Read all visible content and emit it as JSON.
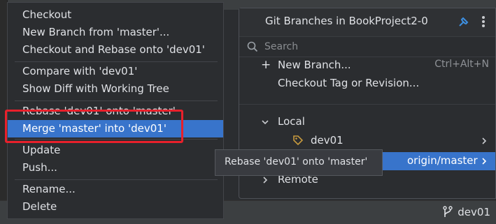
{
  "status_bar": {
    "branch_label": "dev01"
  },
  "context_menu": {
    "items": [
      {
        "label": "Checkout"
      },
      {
        "label": "New Branch from 'master'..."
      },
      {
        "label": "Checkout and Rebase onto 'dev01'"
      },
      {
        "label": "Compare with 'dev01'"
      },
      {
        "label": "Show Diff with Working Tree"
      },
      {
        "label": "Rebase 'dev01' onto 'master'"
      },
      {
        "label": "Merge 'master' into 'dev01'",
        "selected": true
      },
      {
        "label": "Update"
      },
      {
        "label": "Push..."
      },
      {
        "label": "Rename..."
      },
      {
        "label": "Delete"
      }
    ]
  },
  "branches_popup": {
    "title": "Git Branches in BookProject2-0",
    "search_placeholder": "Search",
    "new_branch_label": "New Branch...",
    "new_branch_shortcut": "Ctrl+Alt+N",
    "checkout_tag_label": "Checkout Tag or Revision...",
    "local_label": "Local",
    "local_branches": [
      "dev01"
    ],
    "remote_selected_branch": "origin/master",
    "remote_label": "Remote"
  },
  "tooltip": {
    "text": "Rebase 'dev01' onto 'master'"
  },
  "colors": {
    "selection": "#3874cb",
    "highlight_box": "#e8202b",
    "pin_icon": "#3d8fe0",
    "tag_icon": "#c79a3e"
  }
}
